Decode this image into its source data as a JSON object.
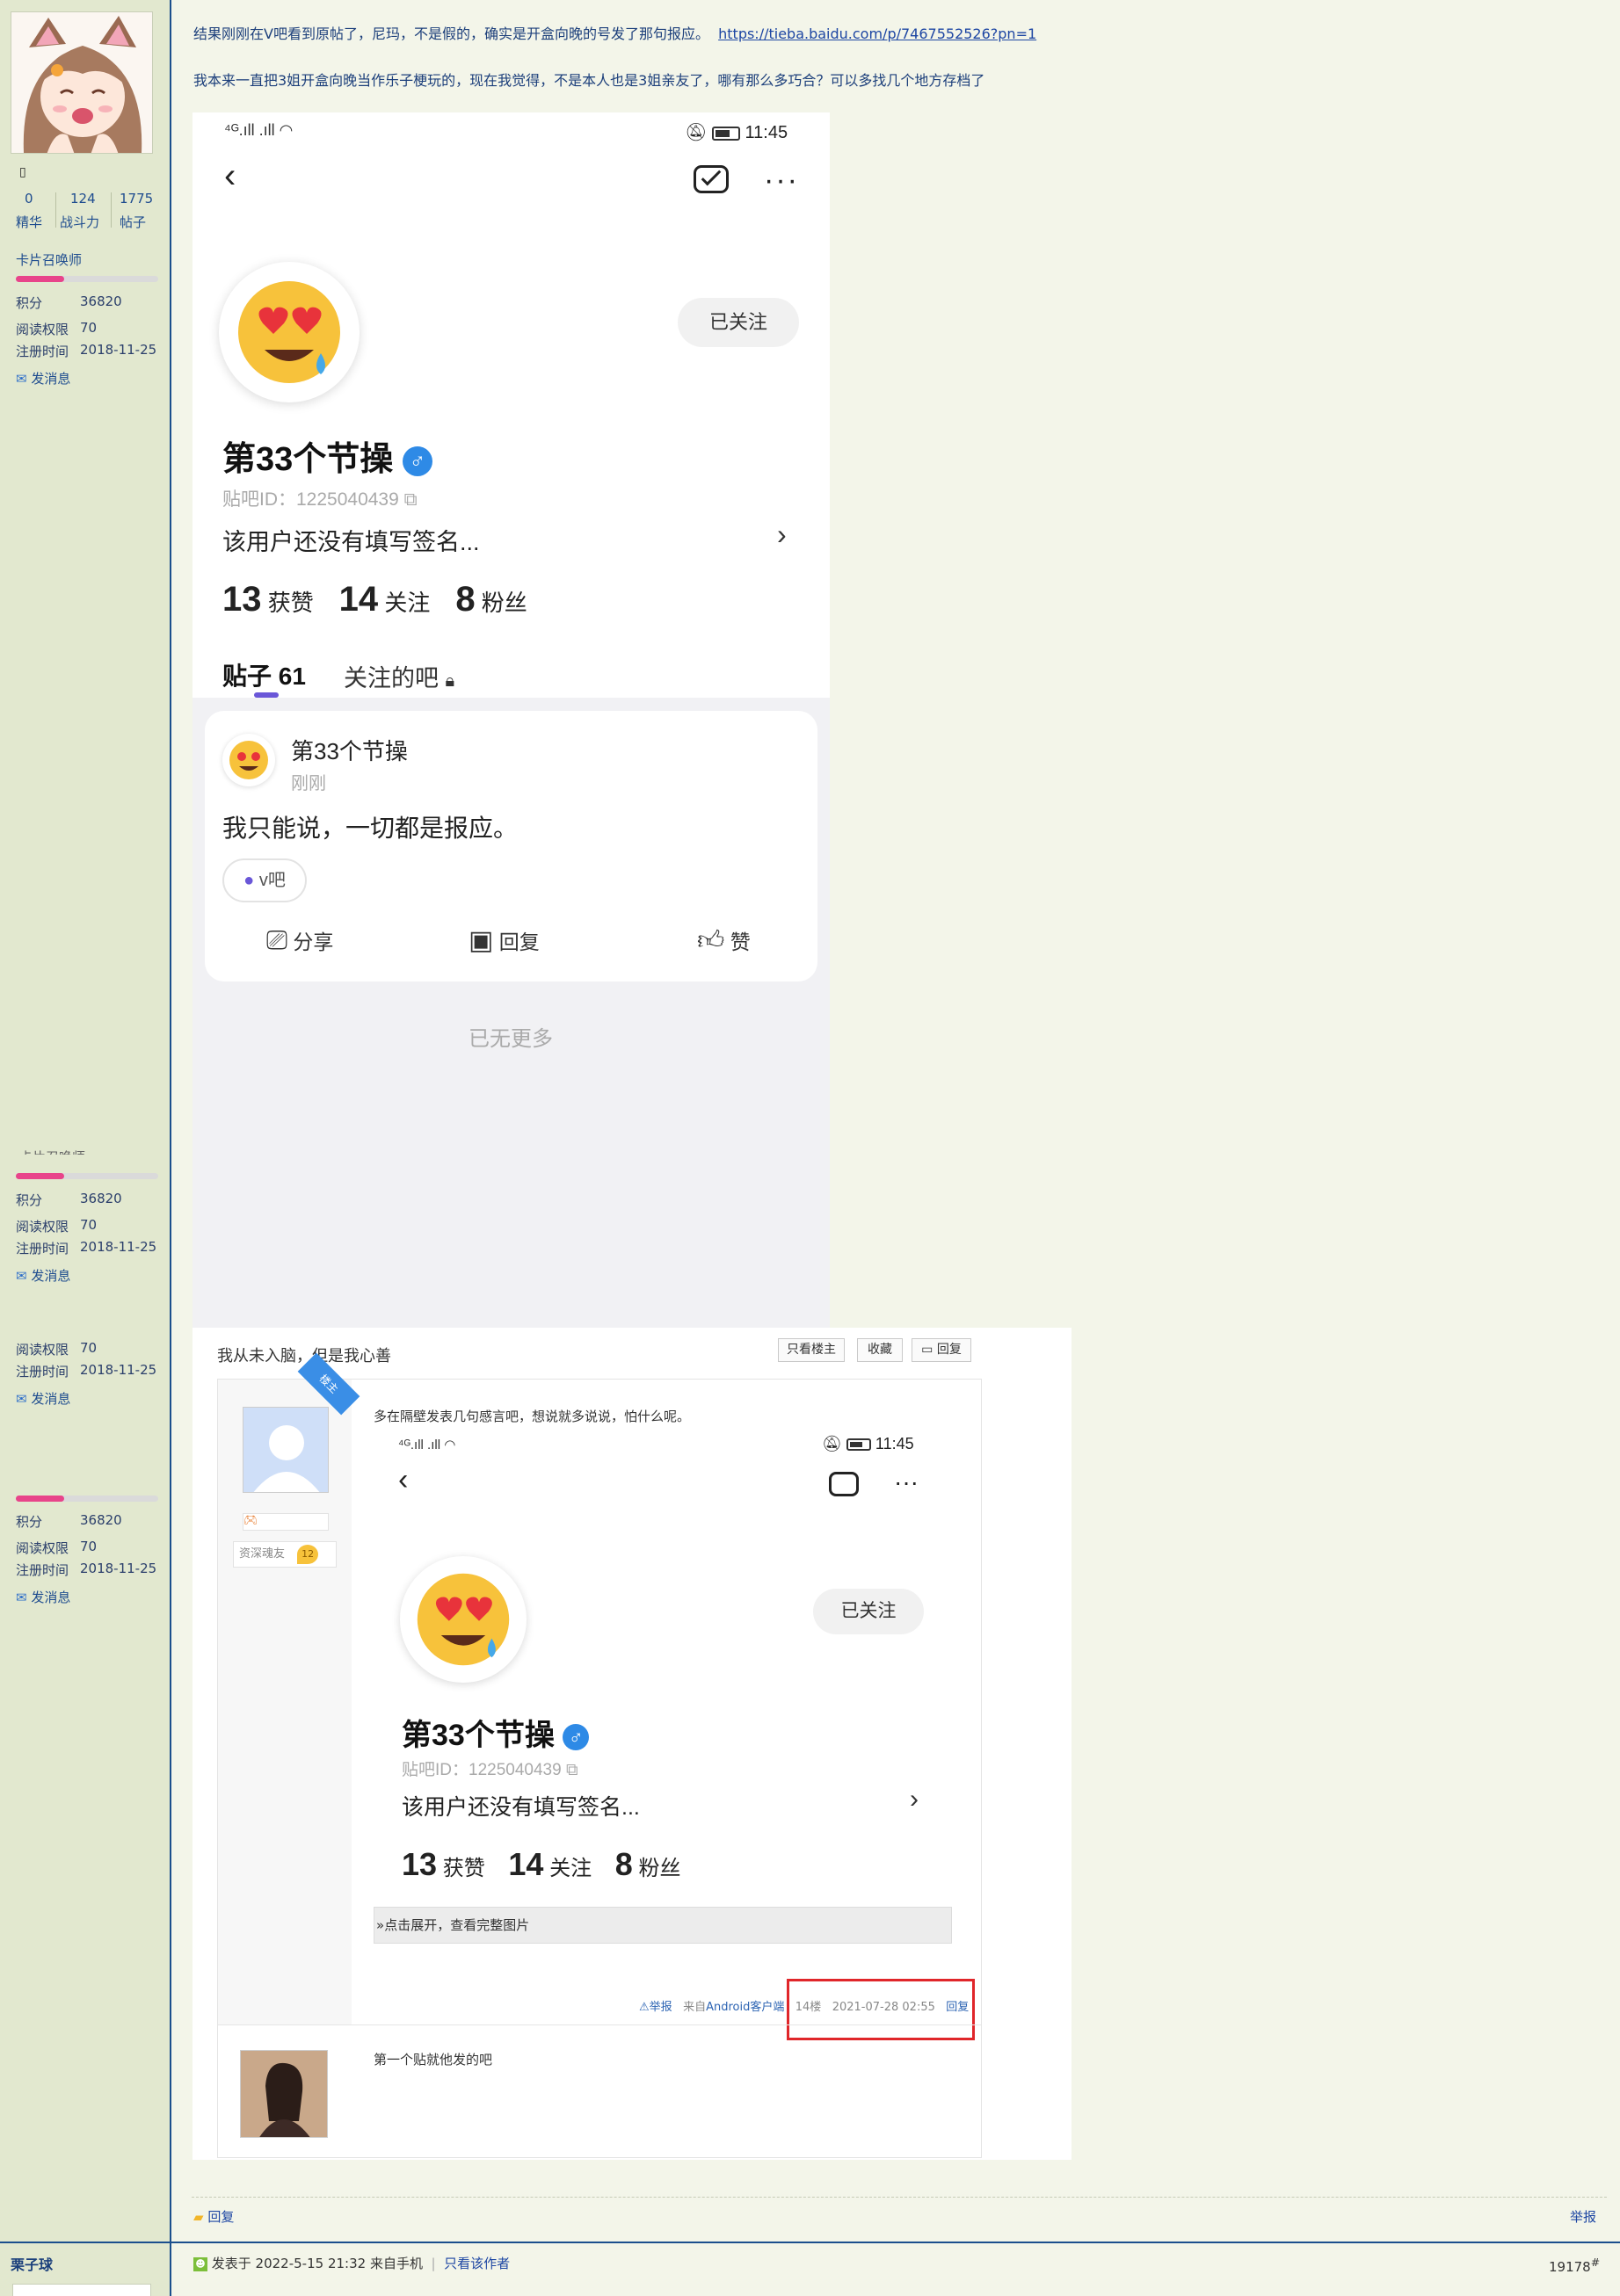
{
  "sidebar": {
    "top_cut_label": "",
    "stats": {
      "values": [
        "0",
        "124",
        "1775"
      ],
      "labels": [
        "精华",
        "战斗力",
        "帖子"
      ]
    },
    "title_label": "卡片召唤师",
    "blocks": [
      {
        "score_label": "积分",
        "score": "36820",
        "read_label": "阅读权限",
        "read": "70",
        "reg_label": "注册时间",
        "reg": "2018-11-25",
        "msg": "发消息"
      },
      {
        "score_label": "积分",
        "score": "36820",
        "read_label": "阅读权限",
        "read": "70",
        "reg_label": "注册时间",
        "reg": "2018-11-25",
        "msg": "发消息"
      },
      {
        "read_label": "阅读权限",
        "read": "70",
        "reg_label": "注册时间",
        "reg": "2018-11-25",
        "msg": "发消息"
      },
      {
        "score_label": "积分",
        "score": "36820",
        "read_label": "阅读权限",
        "read": "70",
        "reg_label": "注册时间",
        "reg": "2018-11-25",
        "msg": "发消息"
      }
    ],
    "next_user": "栗子球"
  },
  "post": {
    "line1_text": "结果刚刚在V吧看到原帖了，尼玛，不是假的，确实是开盒向晚的号发了那句报应。",
    "line1_link": "https://tieba.baidu.com/p/7467552526?pn=1",
    "line2_text": "我本来一直把3姐开盒向晚当作乐子梗玩的，现在我觉得，不是本人也是3姐亲友了，哪有那么多巧合？可以多找几个地方存档了"
  },
  "phone": {
    "time": "11:45",
    "follow_btn": "已关注",
    "username": "第33个节操",
    "tieba_id": "贴吧ID：1225040439",
    "signature": "该用户还没有填写签名...",
    "stats": [
      {
        "num": "13",
        "label": "获赞"
      },
      {
        "num": "14",
        "label": "关注"
      },
      {
        "num": "8",
        "label": "粉丝"
      }
    ],
    "tab_posts": "贴子 61",
    "tab_bars": "关注的吧",
    "card_user": "第33个节操",
    "card_time": "刚刚",
    "card_text": "我只能说，一切都是报应。",
    "card_bar": "v吧",
    "actions": [
      "分享",
      "回复",
      "赞"
    ],
    "no_more": "已无更多"
  },
  "forum": {
    "thread_title": "我从未入脑，但是我心善",
    "buttons": [
      "只看楼主",
      "收藏",
      "回复"
    ],
    "corner_badge": "楼主",
    "rank_label": "资深魂友",
    "rank_level": "12",
    "post_text": "多在隔壁发表几句感言吧，想说就多说说，怕什么呢。",
    "expand": "点击展开，查看完整图片",
    "report": "举报",
    "from": "来自Android客户端",
    "floor": "14楼",
    "datetime": "2021-07-28 02:55",
    "reply": "回复",
    "reply2_text": "第一个贴就他发的吧"
  },
  "footer": {
    "reply": "回复",
    "report": "举报",
    "posted": "发表于 2022-5-15 21:32 来自手机",
    "only_author": "只看该作者",
    "floor": "19178",
    "floor_mark": "#"
  },
  "colors": {
    "sidebar_bg": "#e2e8cf",
    "page_bg": "#f3f5e9",
    "link": "#1d46a3",
    "highlight_box": "#e0262a",
    "bar_fill": "#e8448a"
  }
}
